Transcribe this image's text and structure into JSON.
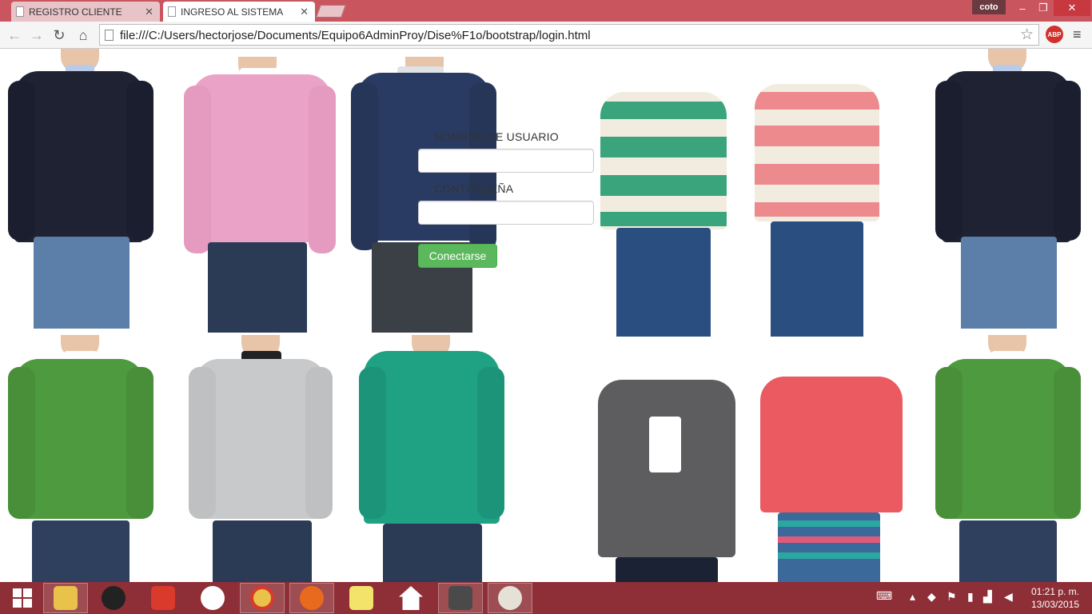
{
  "tabs": [
    {
      "title": "REGISTRO CLIENTE"
    },
    {
      "title": "INGRESO AL SISTEMA"
    }
  ],
  "profile": {
    "name": "coto"
  },
  "toolbar": {
    "url": "file:///C:/Users/hectorjose/Documents/Equipo6AdminProy/Dise%F1o/bootstrap/login.html",
    "adblock_label": "ABP"
  },
  "login": {
    "username_label": "NOMBRE DE USUARIO",
    "password_label": "CONTRASEÑA",
    "submit_label": "Conectarse"
  },
  "taskbar": {
    "apps": [
      "start",
      "file-explorer",
      "webcam",
      "app-grid",
      "hp",
      "chrome",
      "firefox",
      "sticky-notes",
      "home",
      "sublime-text",
      "paint"
    ],
    "clock_time": "01:21 p. m.",
    "clock_date": "13/03/2015"
  },
  "colors": {
    "tab_strip": "#c9565f",
    "taskbar": "#8e2e36",
    "button_green": "#5cb85c"
  }
}
